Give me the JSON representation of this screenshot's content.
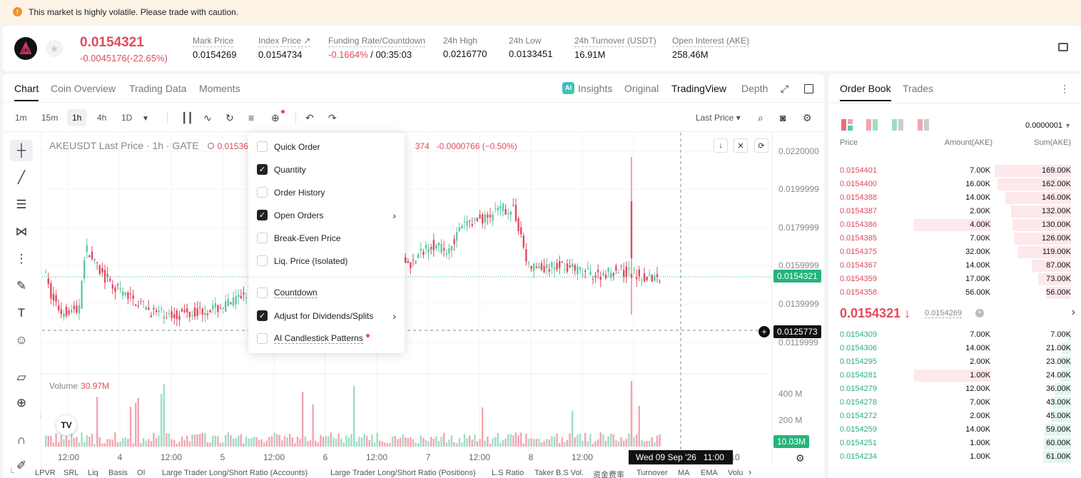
{
  "banner": {
    "text": "This market is highly volatile. Please trade with caution."
  },
  "ticker": {
    "last_price": "0.0154321",
    "change": "-0.0045176(-22.65%)",
    "stats": [
      {
        "label": "Mark Price",
        "value": "0.0154269"
      },
      {
        "label": "Index Price ↗",
        "value": "0.0154734"
      },
      {
        "label": "Funding Rate/Countdown",
        "value_neg": "-0.1664%",
        "value": " / 00:35:03"
      },
      {
        "label": "24h High",
        "value": "0.0216770"
      },
      {
        "label": "24h Low",
        "value": "0.0133451"
      },
      {
        "label": "24h Turnover (USDT)",
        "value": "16.91M"
      },
      {
        "label": "Open Interest (AKE)",
        "value": "258.46M"
      }
    ]
  },
  "chart_tabs": [
    "Chart",
    "Coin Overview",
    "Trading Data",
    "Moments"
  ],
  "view_tabs": [
    "Insights",
    "Original",
    "TradingView",
    "Depth"
  ],
  "timeframes": [
    "1m",
    "15m",
    "1h",
    "4h",
    "1D"
  ],
  "price_type": "Last Price ▾",
  "legend": {
    "symbol": "AKEUSDT Last Price · 1h · GATE",
    "o_label": "O",
    "o_value": "0.01536",
    "tail": "374",
    "change": "-0.0000766 (−0.50%)"
  },
  "volume_legend": {
    "label": "Volume",
    "value": "30.97M"
  },
  "price_axis": [
    "0.0220000",
    "0.0199999",
    "0.0179999",
    "0.0159999",
    "0.0139999",
    "0.0119999"
  ],
  "price_tags": {
    "last": "0.0154321",
    "cursor": "0.0125773",
    "volume": "10.03M"
  },
  "volume_axis": [
    "400 M",
    "200 M"
  ],
  "time_axis": [
    "12:00",
    "4",
    "12:00",
    "5",
    "12:00",
    "6",
    "12:00",
    "7",
    "12:00",
    "8",
    "12:00",
    "10"
  ],
  "crosshair_time": "Wed 09 Sep '26   11:00",
  "menu": {
    "items": [
      {
        "label": "Quick Order",
        "checked": false
      },
      {
        "label": "Quantity",
        "checked": true
      },
      {
        "label": "Order History",
        "checked": false
      },
      {
        "label": "Open Orders",
        "checked": true,
        "submenu": true
      },
      {
        "label": "Break-Even Price",
        "checked": false
      },
      {
        "label": "Liq. Price (Isolated)",
        "checked": false
      },
      {
        "label": "Countdown",
        "checked": false
      },
      {
        "label": "Adjust for Dividends/Splits",
        "checked": true,
        "submenu": true
      },
      {
        "label": "AI Candlestick Patterns",
        "checked": false,
        "dot": true
      }
    ]
  },
  "indicators": [
    "LPVR",
    "SRL",
    "Liq",
    "Basis",
    "OI",
    "Large Trader Long/Short Ratio (Accounts)",
    "Large Trader Long/Short Ratio (Positions)",
    "L.S Ratio",
    "Taker B.S Vol.",
    "资金费率",
    "Turnover",
    "MA",
    "EMA",
    "Volu"
  ],
  "orderbook": {
    "tabs": [
      "Order Book",
      "Trades"
    ],
    "precision": "0.0000001",
    "headers": [
      "Price",
      "Amount(AKE)",
      "Sum(AKE)"
    ],
    "asks": [
      {
        "price": "0.0154401",
        "amount": "7.00K",
        "sum": "169.00K"
      },
      {
        "price": "0.0154400",
        "amount": "16.00K",
        "sum": "162.00K"
      },
      {
        "price": "0.0154388",
        "amount": "14.00K",
        "sum": "146.00K"
      },
      {
        "price": "0.0154387",
        "amount": "2.00K",
        "sum": "132.00K"
      },
      {
        "price": "0.0154386",
        "amount": "4.00K",
        "sum": "130.00K"
      },
      {
        "price": "0.0154385",
        "amount": "7.00K",
        "sum": "126.00K"
      },
      {
        "price": "0.0154375",
        "amount": "32.00K",
        "sum": "119.00K"
      },
      {
        "price": "0.0154367",
        "amount": "14.00K",
        "sum": "87.00K"
      },
      {
        "price": "0.0154359",
        "amount": "17.00K",
        "sum": "73.00K"
      },
      {
        "price": "0.0154358",
        "amount": "56.00K",
        "sum": "56.00K"
      }
    ],
    "mid_price": "0.0154321 ↓",
    "mark_price": "0.0154269",
    "bids": [
      {
        "price": "0.0154309",
        "amount": "7.00K",
        "sum": "7.00K"
      },
      {
        "price": "0.0154306",
        "amount": "14.00K",
        "sum": "21.00K"
      },
      {
        "price": "0.0154295",
        "amount": "2.00K",
        "sum": "23.00K"
      },
      {
        "price": "0.0154281",
        "amount": "1.00K",
        "sum": "24.00K"
      },
      {
        "price": "0.0154279",
        "amount": "12.00K",
        "sum": "36.00K"
      },
      {
        "price": "0.0154278",
        "amount": "7.00K",
        "sum": "43.00K"
      },
      {
        "price": "0.0154272",
        "amount": "2.00K",
        "sum": "45.00K"
      },
      {
        "price": "0.0154259",
        "amount": "14.00K",
        "sum": "59.00K"
      },
      {
        "price": "0.0154251",
        "amount": "1.00K",
        "sum": "60.00K"
      },
      {
        "price": "0.0154234",
        "amount": "1.00K",
        "sum": "61.00K"
      }
    ]
  },
  "colors": {
    "up": "#5fc9a0",
    "down": "#e04a5f",
    "up_bar": "#9fdcc5",
    "down_bar": "#f2a5b0"
  }
}
